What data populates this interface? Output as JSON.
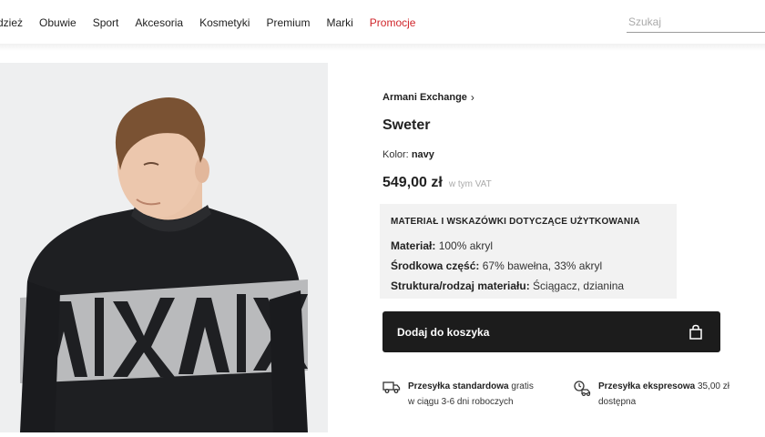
{
  "nav": {
    "items": [
      {
        "label": "dzież",
        "promo": false
      },
      {
        "label": "Obuwie",
        "promo": false
      },
      {
        "label": "Sport",
        "promo": false
      },
      {
        "label": "Akcesoria",
        "promo": false
      },
      {
        "label": "Kosmetyki",
        "promo": false
      },
      {
        "label": "Premium",
        "promo": false
      },
      {
        "label": "Marki",
        "promo": false
      },
      {
        "label": "Promocje",
        "promo": true
      }
    ],
    "search_placeholder": "Szukaj",
    "promo_color": "#d0262b"
  },
  "product": {
    "brand": "Armani Exchange",
    "name": "Sweter",
    "color_label": "Kolor:",
    "color_value": "navy",
    "price": "549,00 zł",
    "vat_note": "w tym VAT",
    "sweater_text": "A|X A|X"
  },
  "materials": {
    "heading": "MATERIAŁ I WSKAZÓWKI DOTYCZĄCE UŻYTKOWANIA",
    "rows": [
      {
        "label": "Materiał:",
        "value": "100% akryl"
      },
      {
        "label": "Środkowa część:",
        "value": "67% bawełna, 33% akryl"
      },
      {
        "label": "Struktura/rodzaj materiału:",
        "value": "Ściągacz, dzianina"
      }
    ]
  },
  "cart": {
    "button_label": "Dodaj do koszyka",
    "icon": "shopping-bag-icon"
  },
  "shipping": [
    {
      "title": "Przesyłka standardowa",
      "suffix": "gratis",
      "detail": "w ciągu 3-6 dni roboczych",
      "icon": "truck-icon"
    },
    {
      "title": "Przesyłka ekspresowa",
      "suffix": "35,00 zł",
      "detail": "dostępna",
      "icon": "fast-delivery-icon"
    }
  ]
}
